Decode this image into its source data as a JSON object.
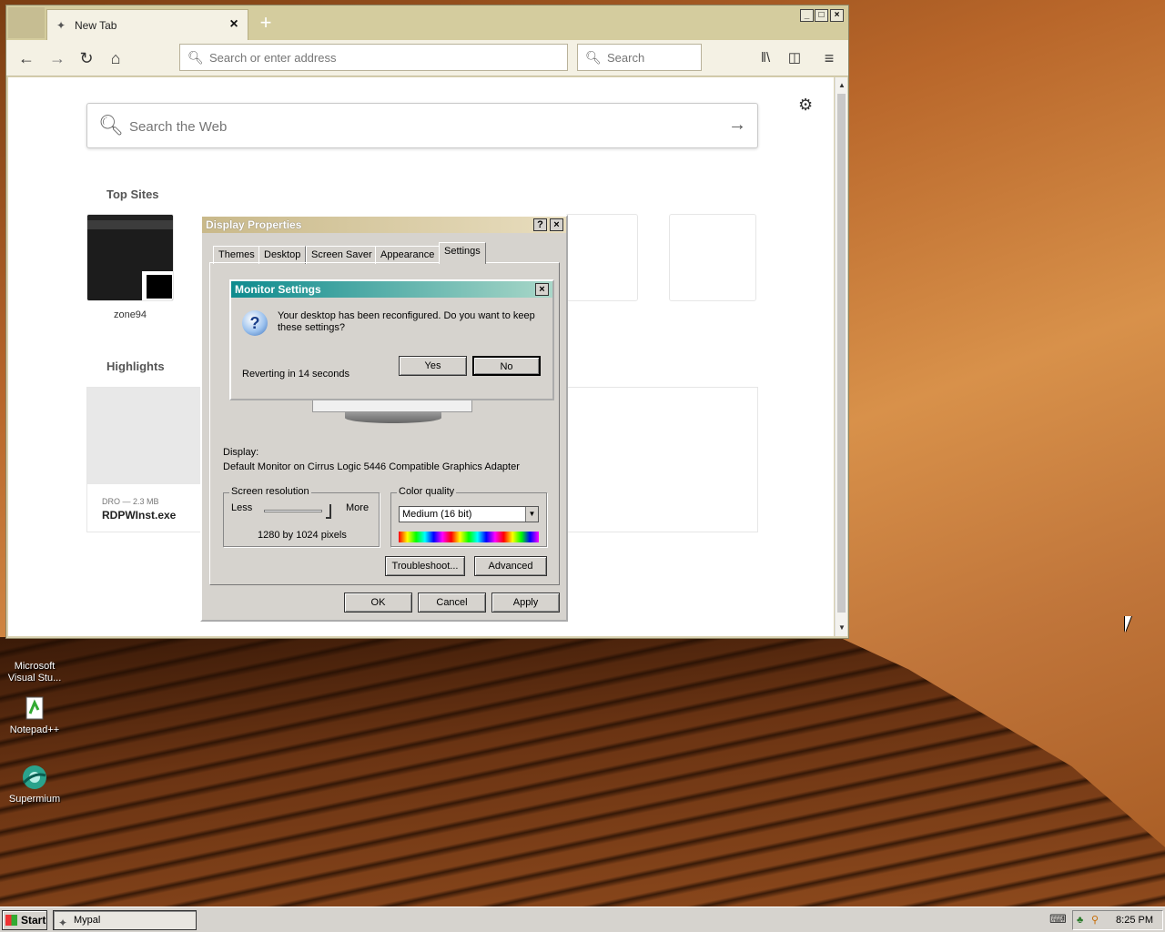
{
  "browser": {
    "tab_title": "New Tab",
    "new_tab_symbol": "+",
    "close_tab_symbol": "×",
    "url_placeholder": "Search or enter address",
    "search_placeholder": "Search",
    "websearch_placeholder": "Search the Web",
    "sections": {
      "top_sites": "Top Sites",
      "highlights": "Highlights"
    },
    "top_sites": [
      {
        "label": "zone94"
      }
    ],
    "highlights": [
      {
        "meta": "DRO — 2.3 MB",
        "name": "RDPWInst.exe"
      }
    ]
  },
  "display_properties": {
    "title": "Display Properties",
    "help_symbol": "?",
    "close_symbol": "×",
    "tabs": [
      "Themes",
      "Desktop",
      "Screen Saver",
      "Appearance",
      "Settings"
    ],
    "active_tab": "Settings",
    "display_label": "Display:",
    "display_value": "Default Monitor on Cirrus Logic 5446 Compatible Graphics Adapter",
    "resolution": {
      "caption": "Screen resolution",
      "less": "Less",
      "more": "More",
      "value": "1280 by 1024 pixels"
    },
    "color_quality": {
      "caption": "Color quality",
      "selected": "Medium (16 bit)"
    },
    "buttons": {
      "troubleshoot": "Troubleshoot...",
      "advanced": "Advanced",
      "ok": "OK",
      "cancel": "Cancel",
      "apply": "Apply"
    }
  },
  "monitor_settings": {
    "title": "Monitor Settings",
    "close_symbol": "×",
    "message": "Your desktop has been reconfigured.  Do you want to keep these settings?",
    "countdown": "Reverting in 14 seconds",
    "yes": "Yes",
    "no": "No"
  },
  "desktop_icons": [
    {
      "label": "Microsoft Visual Stu..."
    },
    {
      "label": "Notepad++"
    },
    {
      "label": "Supermium"
    }
  ],
  "taskbar": {
    "start": "Start",
    "task": "Mypal",
    "clock": "8:25 PM"
  },
  "colors": {
    "monitor_title_start": "#0e8b8e",
    "dialog_face": "#d6d3ce"
  }
}
